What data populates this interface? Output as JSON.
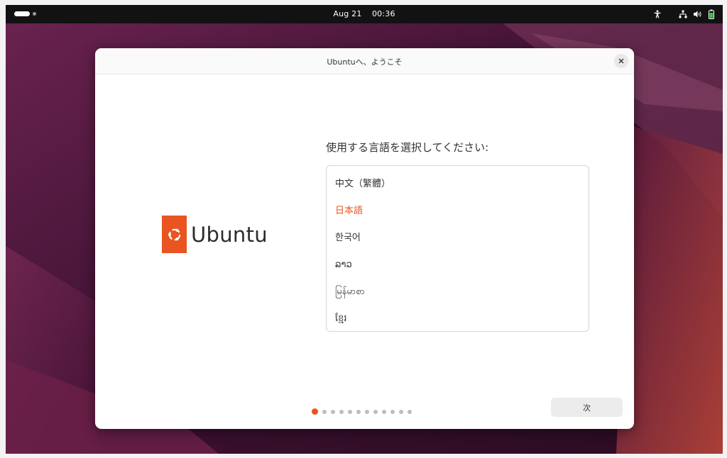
{
  "topbar": {
    "date": "Aug 21",
    "time": "00:36",
    "icons": [
      "activities-pill",
      "workspace-dot",
      "accessibility-icon",
      "network-icon",
      "volume-icon",
      "battery-icon"
    ]
  },
  "dialog": {
    "title": "Ubuntuへ、ようこそ",
    "close_icon": "close-icon"
  },
  "logo": {
    "wordmark": "Ubuntu",
    "brand_color": "#e95420"
  },
  "language_picker": {
    "prompt": "使用する言語を選択してください:",
    "items": [
      {
        "label": "中文（繁體）",
        "selected": false
      },
      {
        "label": "日本語",
        "selected": true
      },
      {
        "label": "한국어",
        "selected": false
      },
      {
        "label": "ລາວ",
        "selected": false
      },
      {
        "label": "မြန်မာစာ",
        "selected": false
      },
      {
        "label": "ខ្មែរ",
        "selected": false
      }
    ]
  },
  "pager": {
    "current_step": 1,
    "total_steps": 12
  },
  "footer": {
    "next_label": "次"
  },
  "colors": {
    "accent": "#e95420",
    "topbar_bg": "#121212",
    "wallpaper_base": "#2a0d24"
  }
}
